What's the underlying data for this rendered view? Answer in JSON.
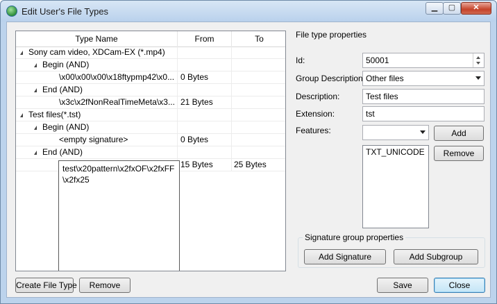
{
  "window": {
    "title": "Edit User's File Types"
  },
  "titlebar_buttons": {
    "minimize": "▁",
    "maximize": "▢",
    "close": "✕"
  },
  "tree": {
    "columns": [
      "Type Name",
      "From",
      "To"
    ],
    "rows": [
      {
        "name": "Sony cam video, XDCam-EX (*.mp4)",
        "from": "",
        "to": ""
      },
      {
        "name": "Begin (AND)",
        "from": "",
        "to": ""
      },
      {
        "name": "\\x00\\x00\\x00\\x18ftypmp42\\x0...",
        "from": "0 Bytes",
        "to": ""
      },
      {
        "name": "End (AND)",
        "from": "",
        "to": ""
      },
      {
        "name": "\\x3c\\x2fNonRealTimeMeta\\x3...",
        "from": "21 Bytes",
        "to": ""
      },
      {
        "name": "Test files(*.tst)",
        "from": "",
        "to": ""
      },
      {
        "name": "Begin (AND)",
        "from": "",
        "to": ""
      },
      {
        "name": "<empty signature>",
        "from": "0 Bytes",
        "to": ""
      },
      {
        "name": "End (AND)",
        "from": "",
        "to": ""
      },
      {
        "name": "",
        "from": "15 Bytes",
        "to": "25 Bytes"
      }
    ],
    "editor_text": "test\\x20pattern\\x2fxOF\\x2fxFF\\x2fx25"
  },
  "props": {
    "section_title": "File type properties",
    "id_label": "Id:",
    "id_value": "50001",
    "group_label": "Group Description:",
    "group_value": "Other files",
    "desc_label": "Description:",
    "desc_value": "Test files",
    "ext_label": "Extension:",
    "ext_value": "tst",
    "features_label": "Features:",
    "features_value": "",
    "add_label": "Add",
    "remove_label": "Remove",
    "features_list": [
      "TXT_UNICODE"
    ]
  },
  "sig_group": {
    "title": "Signature group properties",
    "add_signature": "Add Signature",
    "add_subgroup": "Add Subgroup"
  },
  "footer": {
    "create_label": "Create File Type",
    "remove_label": "Remove",
    "save_label": "Save",
    "close_label": "Close"
  }
}
